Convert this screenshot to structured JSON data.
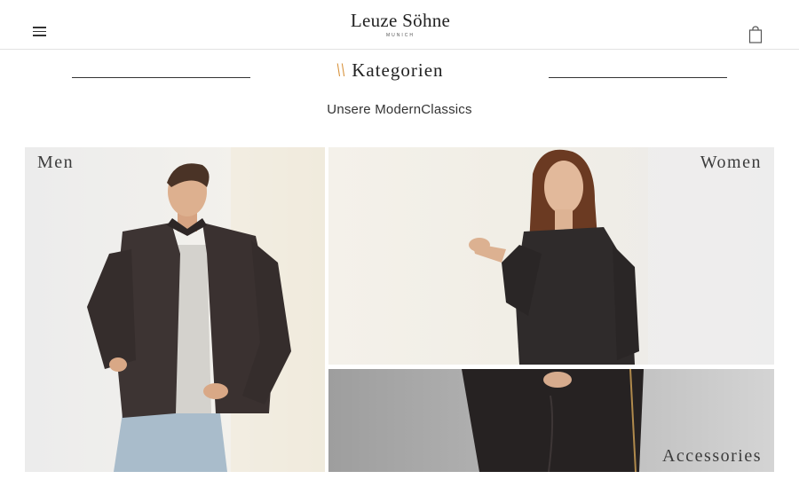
{
  "header": {
    "logo_main": "Leuze Söhne",
    "logo_sub": "MUNICH",
    "menu_icon": "hamburger-menu-icon",
    "cart_icon": "shopping-bag-icon"
  },
  "section": {
    "accent": "\\\\",
    "title": "Kategorien",
    "subtitle": "Unsere ModernClassics",
    "accent_color": "#d7913a"
  },
  "categories": [
    {
      "label": "Men"
    },
    {
      "label": "Women"
    },
    {
      "label": "Accessories"
    }
  ]
}
